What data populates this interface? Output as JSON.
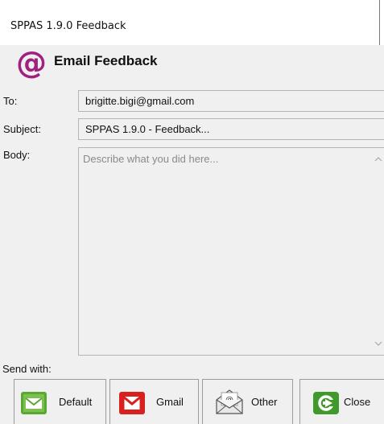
{
  "window": {
    "title": "SPPAS 1.9.0 Feedback"
  },
  "header": {
    "title": "Email Feedback",
    "icon": "at-sign-icon"
  },
  "form": {
    "to_label": "To:",
    "to_value": "brigitte.bigi@gmail.com",
    "subject_label": "Subject:",
    "subject_value": "SPPAS 1.9.0 - Feedback...",
    "body_label": "Body:",
    "body_placeholder": "Describe what you did here..."
  },
  "send_with": {
    "label": "Send with:",
    "buttons": [
      {
        "label": "Default",
        "icon": "envelope-icon"
      },
      {
        "label": "Gmail",
        "icon": "gmail-icon"
      },
      {
        "label": "Other",
        "icon": "open-envelope-at-icon"
      },
      {
        "label": "Close",
        "icon": "exit-icon"
      }
    ]
  },
  "colors": {
    "accent": "#a0207f",
    "default_icon": "#5aa832",
    "gmail_icon": "#d9201f",
    "close_icon": "#3f9a2b"
  }
}
